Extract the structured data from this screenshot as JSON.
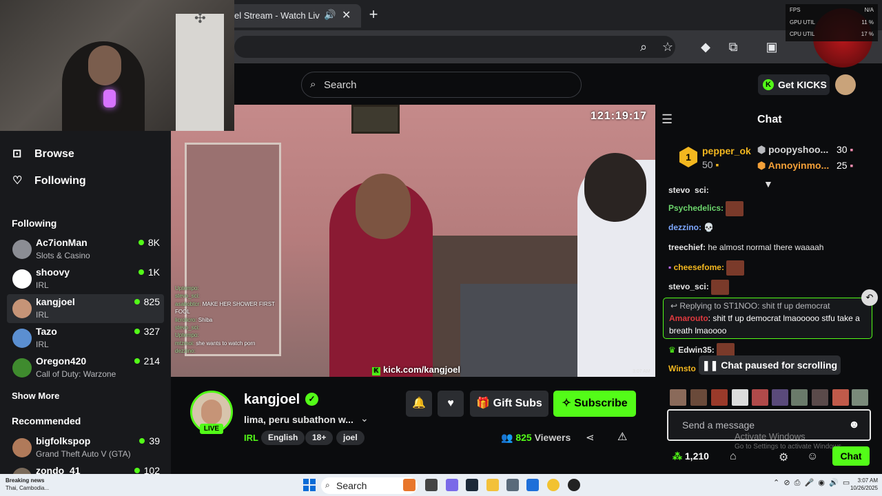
{
  "browser": {
    "tab_title": "el Stream - Watch Liv",
    "new_tab": "+"
  },
  "overlay": {
    "perf": [
      {
        "label": "FPS",
        "value": "N/A"
      },
      {
        "label": "GPU UTIL",
        "value": "11 %"
      },
      {
        "label": "CPU UTIL",
        "value": "17 %"
      }
    ]
  },
  "header": {
    "search_placeholder": "Search",
    "get_kicks": "Get KICKS"
  },
  "sidebar": {
    "nav": [
      {
        "label": "Browse",
        "icon": "browse-icon"
      },
      {
        "label": "Following",
        "icon": "heart-icon"
      }
    ],
    "following_title": "Following",
    "following": [
      {
        "name": "Ac7ionMan",
        "category": "Slots & Casino",
        "viewers": "8K",
        "color": "#8b8d94"
      },
      {
        "name": "shoovy",
        "category": "IRL",
        "viewers": "1K",
        "color": "#ffffff"
      },
      {
        "name": "kangjoel",
        "category": "IRL",
        "viewers": "825",
        "color": "#c69477"
      },
      {
        "name": "Tazo",
        "category": "IRL",
        "viewers": "327",
        "color": "#5b8fd1"
      },
      {
        "name": "Oregon420",
        "category": "Call of Duty: Warzone",
        "viewers": "214",
        "color": "#3f8b2e"
      }
    ],
    "show_more": "Show More",
    "recommended_title": "Recommended",
    "recommended": [
      {
        "name": "bigfolkspop",
        "category": "Grand Theft Auto V (GTA)",
        "viewers": "39",
        "color": "#b07a5a"
      },
      {
        "name": "zondo_41",
        "category": "",
        "viewers": "102",
        "color": "#7a6a5a"
      }
    ]
  },
  "video": {
    "timer": "121:19:17",
    "watermark": "kick.com/kangjoel",
    "clock": "3:07 AM",
    "chat_overlay": [
      {
        "user": "Uptempo:",
        "text": ""
      },
      {
        "user": "stevo_sci:",
        "text": ""
      },
      {
        "user": "asabobtcr:",
        "text": "MAKE HER SHOWER FIRST"
      },
      {
        "user": "",
        "text": "FOOL"
      },
      {
        "user": "licrolicro:",
        "text": "Shiba"
      },
      {
        "user": "stevo_sci:",
        "text": ""
      },
      {
        "user": "Uptempo:",
        "text": ""
      },
      {
        "user": "mtzmoi:",
        "text": "she wants to watch porn"
      },
      {
        "user": "dezzino:",
        "text": ""
      }
    ]
  },
  "stream": {
    "name": "kangjoel",
    "live": "LIVE",
    "title": "lima, peru subathon w...",
    "category": "IRL",
    "tags": [
      "English",
      "18+",
      "joel"
    ],
    "gift_subs": "Gift Subs",
    "subscribe": "Subscribe",
    "viewers": "825",
    "viewers_label": "Viewers"
  },
  "chat": {
    "title": "Chat",
    "leaderboard": [
      {
        "rank": "1",
        "name": "pepper_ok",
        "amount": "50"
      },
      {
        "rank": "2",
        "name": "poopyshoo...",
        "amount": "30"
      },
      {
        "rank": "3",
        "name": "Annoyinmo...",
        "amount": "25"
      }
    ],
    "messages": [
      {
        "user": "stevo_sci:",
        "text": "",
        "color": "#e6e6e6"
      },
      {
        "user": "Psychedelics:",
        "text": "",
        "color": "#6cd66c"
      },
      {
        "user": "dezzino:",
        "text": "",
        "color": "#7ea8ff"
      },
      {
        "user": "treechief:",
        "text": "he almost normal there waaaah",
        "color": "#e6e6e6"
      },
      {
        "user": "cheesefome:",
        "text": "",
        "color": "#f3b71f"
      },
      {
        "user": "stevo_sci:",
        "text": "",
        "color": "#e6e6e6"
      }
    ],
    "reply_to": "Replying to ST1NOO: shit tf up democrat",
    "reply_user": "Amarouto",
    "reply_text": ": shit tf up democrat lmaooooo stfu take a breath lmaoooo",
    "after_reply": [
      {
        "user": "Edwin35:",
        "text": ""
      },
      {
        "user": "Winsto",
        "text": ""
      }
    ],
    "paused": "Chat paused for scrolling",
    "input_placeholder": "Send a message",
    "kicks_balance": "1,210",
    "chat_button": "Chat",
    "watermark_title": "Activate Windows",
    "watermark_sub": "Go to Settings to activate Windows."
  },
  "taskbar": {
    "news_title": "Breaking news",
    "news_sub": "Thai, Cambodia...",
    "search": "Search",
    "time": "3:07 AM",
    "date": "10/26/2025"
  }
}
